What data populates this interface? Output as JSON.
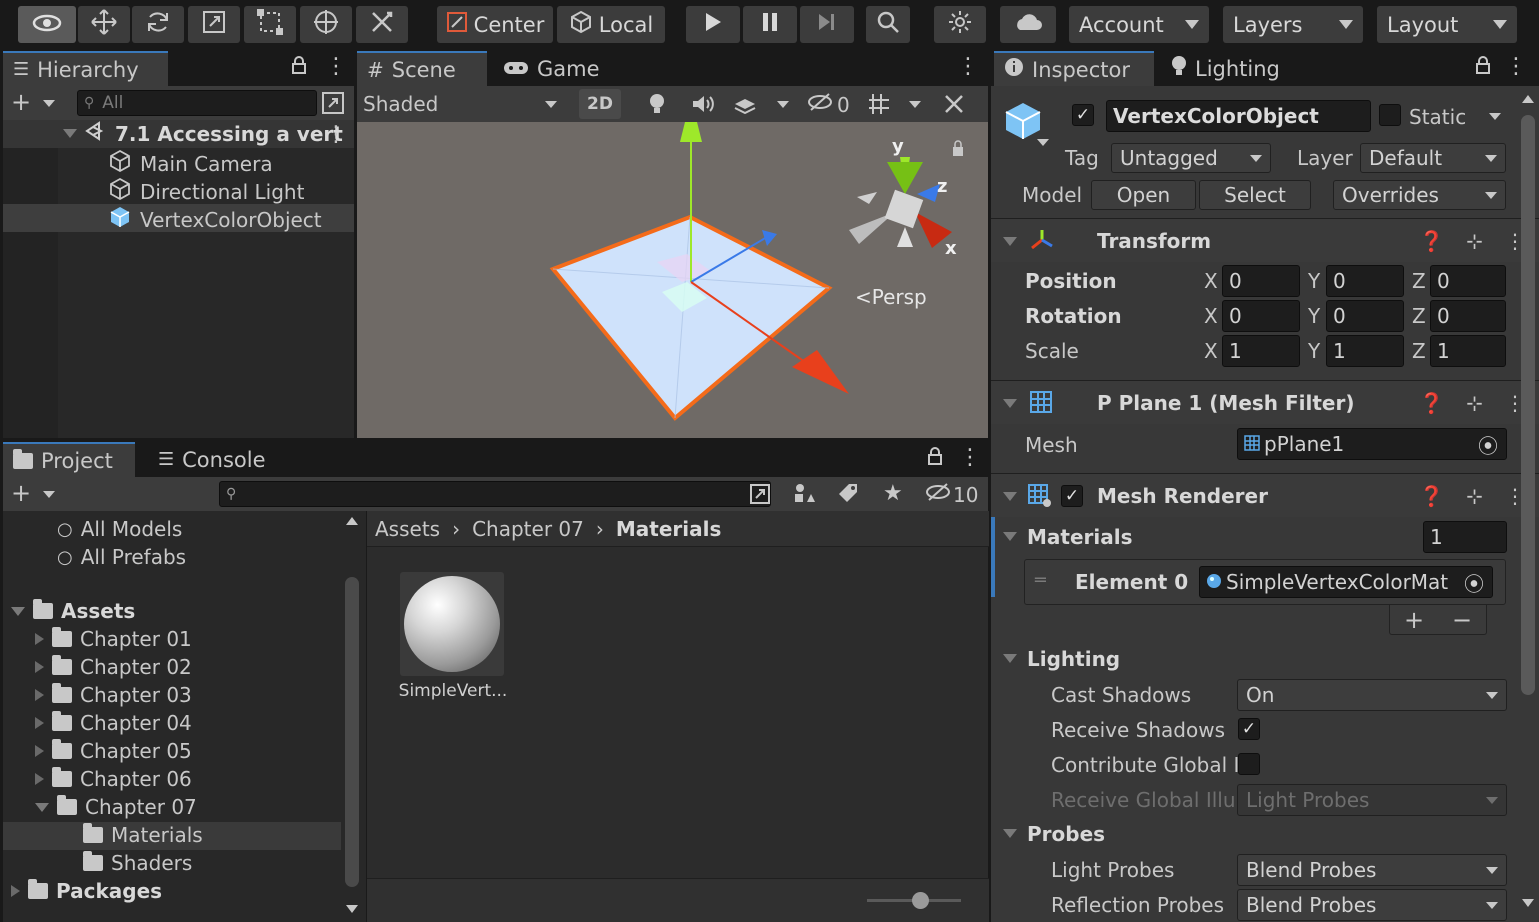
{
  "toolbar": {
    "center_label": "Center",
    "local_label": "Local",
    "account_label": "Account",
    "layers_label": "Layers",
    "layout_label": "Layout"
  },
  "hierarchy": {
    "tab_label": "Hierarchy",
    "search_placeholder": "All",
    "scene_name": "7.1 Accessing a vert",
    "items": [
      "Main Camera",
      "Directional Light",
      "VertexColorObject"
    ]
  },
  "scene": {
    "tabs": [
      "Scene",
      "Game"
    ],
    "shading_mode": "Shaded",
    "mode_2d": "2D",
    "hidden_count": "0",
    "persp_label": "Persp",
    "axis_labels": [
      "y",
      "z",
      "x"
    ]
  },
  "project": {
    "tabs": [
      "Project",
      "Console"
    ],
    "hidden_count": "10",
    "favorites": [
      "All Models",
      "All Prefabs"
    ],
    "assets_label": "Assets",
    "chapters": [
      "Chapter 01",
      "Chapter 02",
      "Chapter 03",
      "Chapter 04",
      "Chapter 05",
      "Chapter 06",
      "Chapter 07"
    ],
    "chapter07_children": [
      "Materials",
      "Shaders"
    ],
    "packages_label": "Packages",
    "breadcrumb": [
      "Assets",
      "Chapter 07",
      "Materials"
    ],
    "asset_items": [
      {
        "name": "SimpleVert..."
      }
    ]
  },
  "inspector": {
    "tabs": [
      "Inspector",
      "Lighting"
    ],
    "object_name": "VertexColorObject",
    "static_label": "Static",
    "tag_label": "Tag",
    "tag_value": "Untagged",
    "layer_label": "Layer",
    "layer_value": "Default",
    "model_label": "Model",
    "model_buttons": [
      "Open",
      "Select",
      "Overrides"
    ],
    "transform": {
      "title": "Transform",
      "rows": [
        {
          "label": "Position",
          "x": "0",
          "y": "0",
          "z": "0"
        },
        {
          "label": "Rotation",
          "x": "0",
          "y": "0",
          "z": "0"
        },
        {
          "label": "Scale",
          "x": "1",
          "y": "1",
          "z": "1"
        }
      ],
      "axis": [
        "X",
        "Y",
        "Z"
      ]
    },
    "mesh_filter": {
      "title": "P Plane 1 (Mesh Filter)",
      "mesh_label": "Mesh",
      "mesh_value": "pPlane1"
    },
    "mesh_renderer": {
      "title": "Mesh Renderer",
      "materials_label": "Materials",
      "materials_count": "1",
      "element_label": "Element 0",
      "element_value": "SimpleVertexColorMat",
      "add_label": "+",
      "remove_label": "−",
      "lighting_label": "Lighting",
      "cast_shadows_label": "Cast Shadows",
      "cast_shadows_value": "On",
      "receive_shadows_label": "Receive Shadows",
      "contribute_gi_label": "Contribute Global Il",
      "receive_gi_label": "Receive Global Illu",
      "receive_gi_value": "Light Probes",
      "probes_label": "Probes",
      "light_probes_label": "Light Probes",
      "light_probes_value": "Blend Probes",
      "reflection_probes_label": "Reflection Probes",
      "reflection_probes_value": "Blend Probes"
    }
  },
  "colors": {
    "accent": "#3a79bb",
    "plane_edge": "#f46b1a",
    "plane_fill": "#cfe2fb",
    "axis_x": "#e8401c",
    "axis_y": "#9ee82a",
    "axis_z": "#3a7ae8"
  }
}
